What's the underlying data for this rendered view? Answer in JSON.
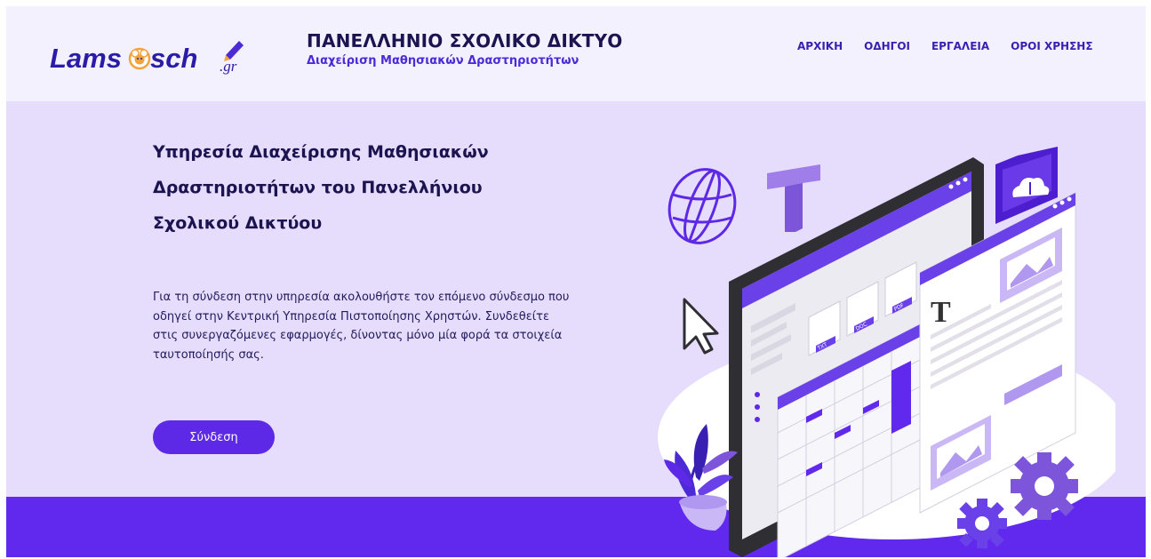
{
  "header": {
    "logo_text": "Lams",
    "logo_text2": "sch",
    "logo_tld": ".gr",
    "title": "ΠΑΝΕΛΛΗΝΙΟ ΣΧΟΛΙΚΟ ΔΙΚΤΥΟ",
    "subtitle": "Διαχείριση Μαθησιακών Δραστηριοτήτων"
  },
  "nav": {
    "items": [
      {
        "label": "ΑΡΧΙΚΗ"
      },
      {
        "label": "ΟΔΗΓΟΙ"
      },
      {
        "label": "ΕΡΓΑΛΕΙΑ"
      },
      {
        "label": "ΟΡΟΙ ΧΡΗΣΗΣ"
      }
    ]
  },
  "hero": {
    "title_lines": [
      "Υπηρεσία Διαχείρισης Μαθησιακών",
      "Δραστηριοτήτων του Πανελλήνιου",
      "Σχολικού Δικτύου"
    ],
    "text_lines": [
      "Για τη σύνδεση στην υπηρεσία ακολουθήστε τον επόμενο  σύνδεσμο που",
      "οδηγεί στην Κεντρική Υπηρεσία Πιστοποίησης Χρηστών. Συνδεθείτε",
      "στις συνεργαζόμενες εφαρμογές, δίνοντας μόνο μία φορά τα στοιχεία",
      "ταυτοποίησής σας."
    ],
    "login_label": "Σύνδεση"
  },
  "illustration": {
    "letter": "T",
    "doc_labels": [
      "TXT",
      "DOC",
      "PDF"
    ]
  },
  "colors": {
    "header_bg": "#f3f1fd",
    "hero_bg": "#e6dcfb",
    "accent": "#5d28e6",
    "band": "#6128ee",
    "title_text": "#1c1450"
  }
}
